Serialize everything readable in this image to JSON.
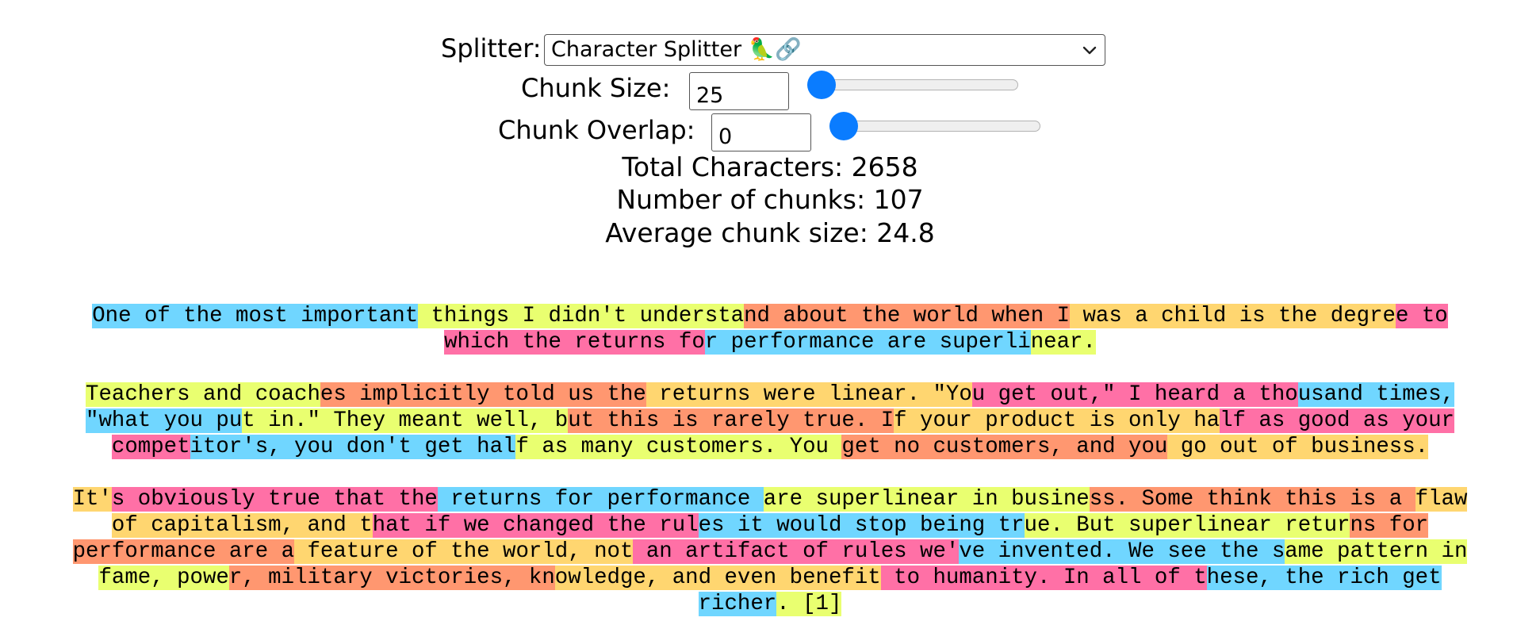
{
  "controls": {
    "splitter_label": "Splitter:",
    "splitter_value": "Character Splitter 🦜🔗",
    "chunk_size_label": "Chunk Size:",
    "chunk_size_value": "25",
    "chunk_size_slider_level": 0,
    "chunk_overlap_label": "Chunk Overlap:",
    "chunk_overlap_value": "0",
    "chunk_overlap_slider_level": 0,
    "accent_color": "#0a7cff",
    "icons": [
      "chevron-down-icon"
    ]
  },
  "stats": {
    "total_characters": "Total Characters: 2658",
    "number_of_chunks": "Number of chunks: 107",
    "average_chunk_size": "Average chunk size: 24.8"
  },
  "chunk_colors": [
    "#70d6ff",
    "#e9ff70",
    "#ff9770",
    "#ffd670",
    "#ff70a6"
  ],
  "paragraphs": [
    {
      "lines": [
        [
          {
            "t": "One of the most important",
            "c": 0
          },
          {
            "t": " things I didn't understa",
            "c": 1
          },
          {
            "t": "nd about the world when I",
            "c": 2
          },
          {
            "t": " was a child is the degre",
            "c": 3
          },
          {
            "t": "e to",
            "c": 4
          }
        ],
        [
          {
            "t": "which the returns fo",
            "c": 4
          },
          {
            "t": "r performance are superli",
            "c": 0
          },
          {
            "t": "near.",
            "c": 1
          }
        ]
      ]
    },
    {
      "lines": [
        [
          {
            "t": "Teachers and coach",
            "c": 1
          },
          {
            "t": "es implicitly told us the",
            "c": 2
          },
          {
            "t": " returns were linear. \"Yo",
            "c": 3
          },
          {
            "t": "u get out,\" I heard a tho",
            "c": 4
          },
          {
            "t": "usand times,",
            "c": 0
          }
        ],
        [
          {
            "t": "\"what you pu",
            "c": 0
          },
          {
            "t": "t in.\" They meant well, b",
            "c": 1
          },
          {
            "t": "ut this is rarely true. I",
            "c": 2
          },
          {
            "t": "f your product is only ha",
            "c": 3
          },
          {
            "t": "lf as good as your",
            "c": 4
          }
        ],
        [
          {
            "t": "compet",
            "c": 4
          },
          {
            "t": "itor's, you don't get hal",
            "c": 0
          },
          {
            "t": "f as many customers. You ",
            "c": 1
          },
          {
            "t": "get no customers, and you",
            "c": 2
          },
          {
            "t": " go out of business.",
            "c": 3
          }
        ]
      ]
    },
    {
      "lines": [
        [
          {
            "t": "It'",
            "c": 3
          },
          {
            "t": "s obviously true that the",
            "c": 4
          },
          {
            "t": " returns for performance ",
            "c": 0
          },
          {
            "t": "are superlinear in busine",
            "c": 1
          },
          {
            "t": "ss. Some think this is a ",
            "c": 2
          },
          {
            "t": "flaw",
            "c": 3
          }
        ],
        [
          {
            "t": "of capitalism, and t",
            "c": 3
          },
          {
            "t": "hat if we changed the rul",
            "c": 4
          },
          {
            "t": "es it would stop being tr",
            "c": 0
          },
          {
            "t": "ue. But superlinear retur",
            "c": 1
          },
          {
            "t": "ns for",
            "c": 2
          }
        ],
        [
          {
            "t": "performance are a",
            "c": 2
          },
          {
            "t": " feature of the world, not",
            "c": 3
          },
          {
            "t": " an artifact of rules we'",
            "c": 4
          },
          {
            "t": "ve invented. We see the s",
            "c": 0
          },
          {
            "t": "ame pattern in",
            "c": 1
          }
        ],
        [
          {
            "t": "fame, powe",
            "c": 1
          },
          {
            "t": "r, military victories, kn",
            "c": 2
          },
          {
            "t": "owledge, and even benefit",
            "c": 3
          },
          {
            "t": " to humanity. In all of t",
            "c": 4
          },
          {
            "t": "hese, the rich get",
            "c": 0
          }
        ],
        [
          {
            "t": "richer",
            "c": 0
          },
          {
            "t": ". [1]",
            "c": 1
          }
        ]
      ]
    }
  ]
}
